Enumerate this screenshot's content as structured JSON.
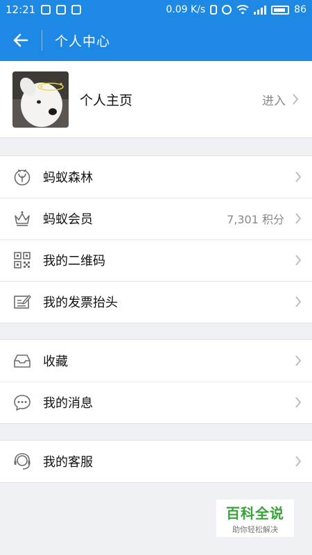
{
  "status_bar": {
    "time": "12:21",
    "speed": "0.09 K/s",
    "battery": "86"
  },
  "header": {
    "title": "个人中心"
  },
  "profile": {
    "label": "个人主页",
    "action": "进入"
  },
  "menu": {
    "group1": [
      {
        "label": "蚂蚁森林",
        "icon": "sprout-icon"
      },
      {
        "label": "蚂蚁会员",
        "icon": "crown-icon",
        "extra": "7,301 积分"
      },
      {
        "label": "我的二维码",
        "icon": "qr-code-icon"
      },
      {
        "label": "我的发票抬头",
        "icon": "invoice-edit-icon"
      }
    ],
    "group2": [
      {
        "label": "收藏",
        "icon": "inbox-tray-icon"
      },
      {
        "label": "我的消息",
        "icon": "chat-bubble-icon"
      }
    ],
    "group3": [
      {
        "label": "我的客服",
        "icon": "headset-icon"
      }
    ]
  },
  "watermark": {
    "title": "百科全说",
    "subtitle": "助你轻松解决"
  },
  "colors": {
    "primary": "#1e88e5",
    "background": "#eff0f4",
    "watermark_green": "#3aa23a"
  }
}
